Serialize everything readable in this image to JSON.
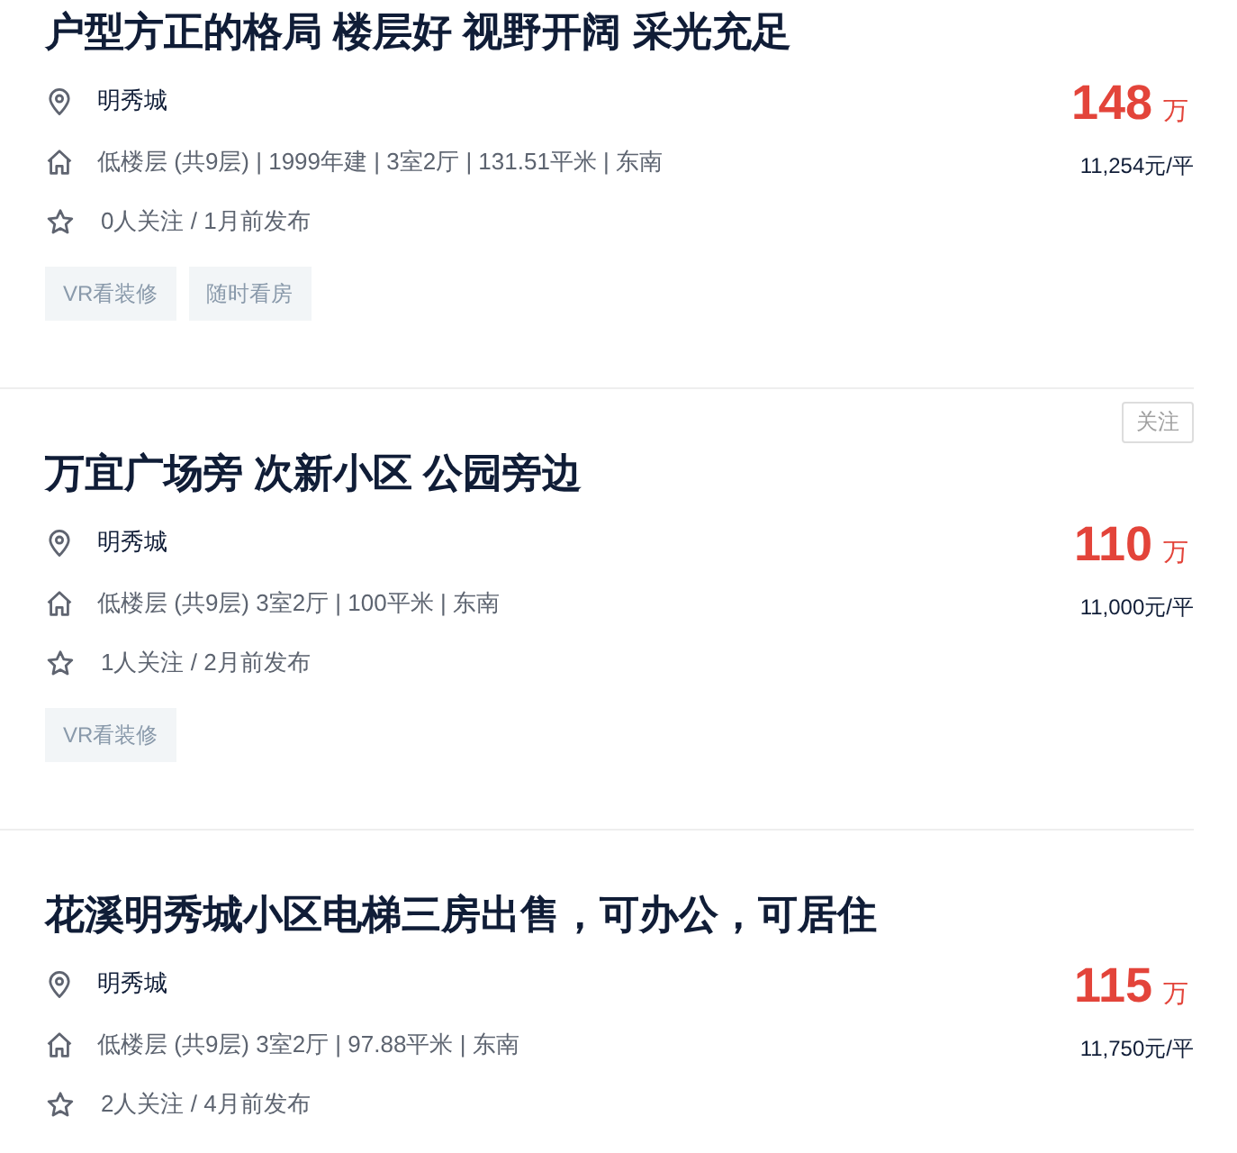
{
  "listings": [
    {
      "title": "户型方正的格局 楼层好 视野开阔 采光充足",
      "community": "明秀城",
      "house_info": "低楼层 (共9层) | 1999年建 | 3室2厅 | 131.51平米 | 东南",
      "follow_info": "0人关注 / 1月前发布",
      "tags": [
        "VR看装修",
        "随时看房"
      ],
      "total_price": "148",
      "price_unit": "万",
      "unit_price": "11,254元/平"
    },
    {
      "title": "万宜广场旁 次新小区 公园旁边",
      "follow_button": "关注",
      "community": "明秀城",
      "house_info": "低楼层 (共9层) 3室2厅 | 100平米 | 东南",
      "follow_info": "1人关注 / 2月前发布",
      "tags": [
        "VR看装修"
      ],
      "total_price": "110",
      "price_unit": "万",
      "unit_price": "11,000元/平"
    },
    {
      "title": "花溪明秀城小区电梯三房出售，可办公，可居住",
      "community": "明秀城",
      "house_info": "低楼层 (共9层) 3室2厅 | 97.88平米 | 东南",
      "follow_info": "2人关注 / 4月前发布",
      "total_price": "115",
      "price_unit": "万",
      "unit_price": "11,750元/平"
    }
  ]
}
